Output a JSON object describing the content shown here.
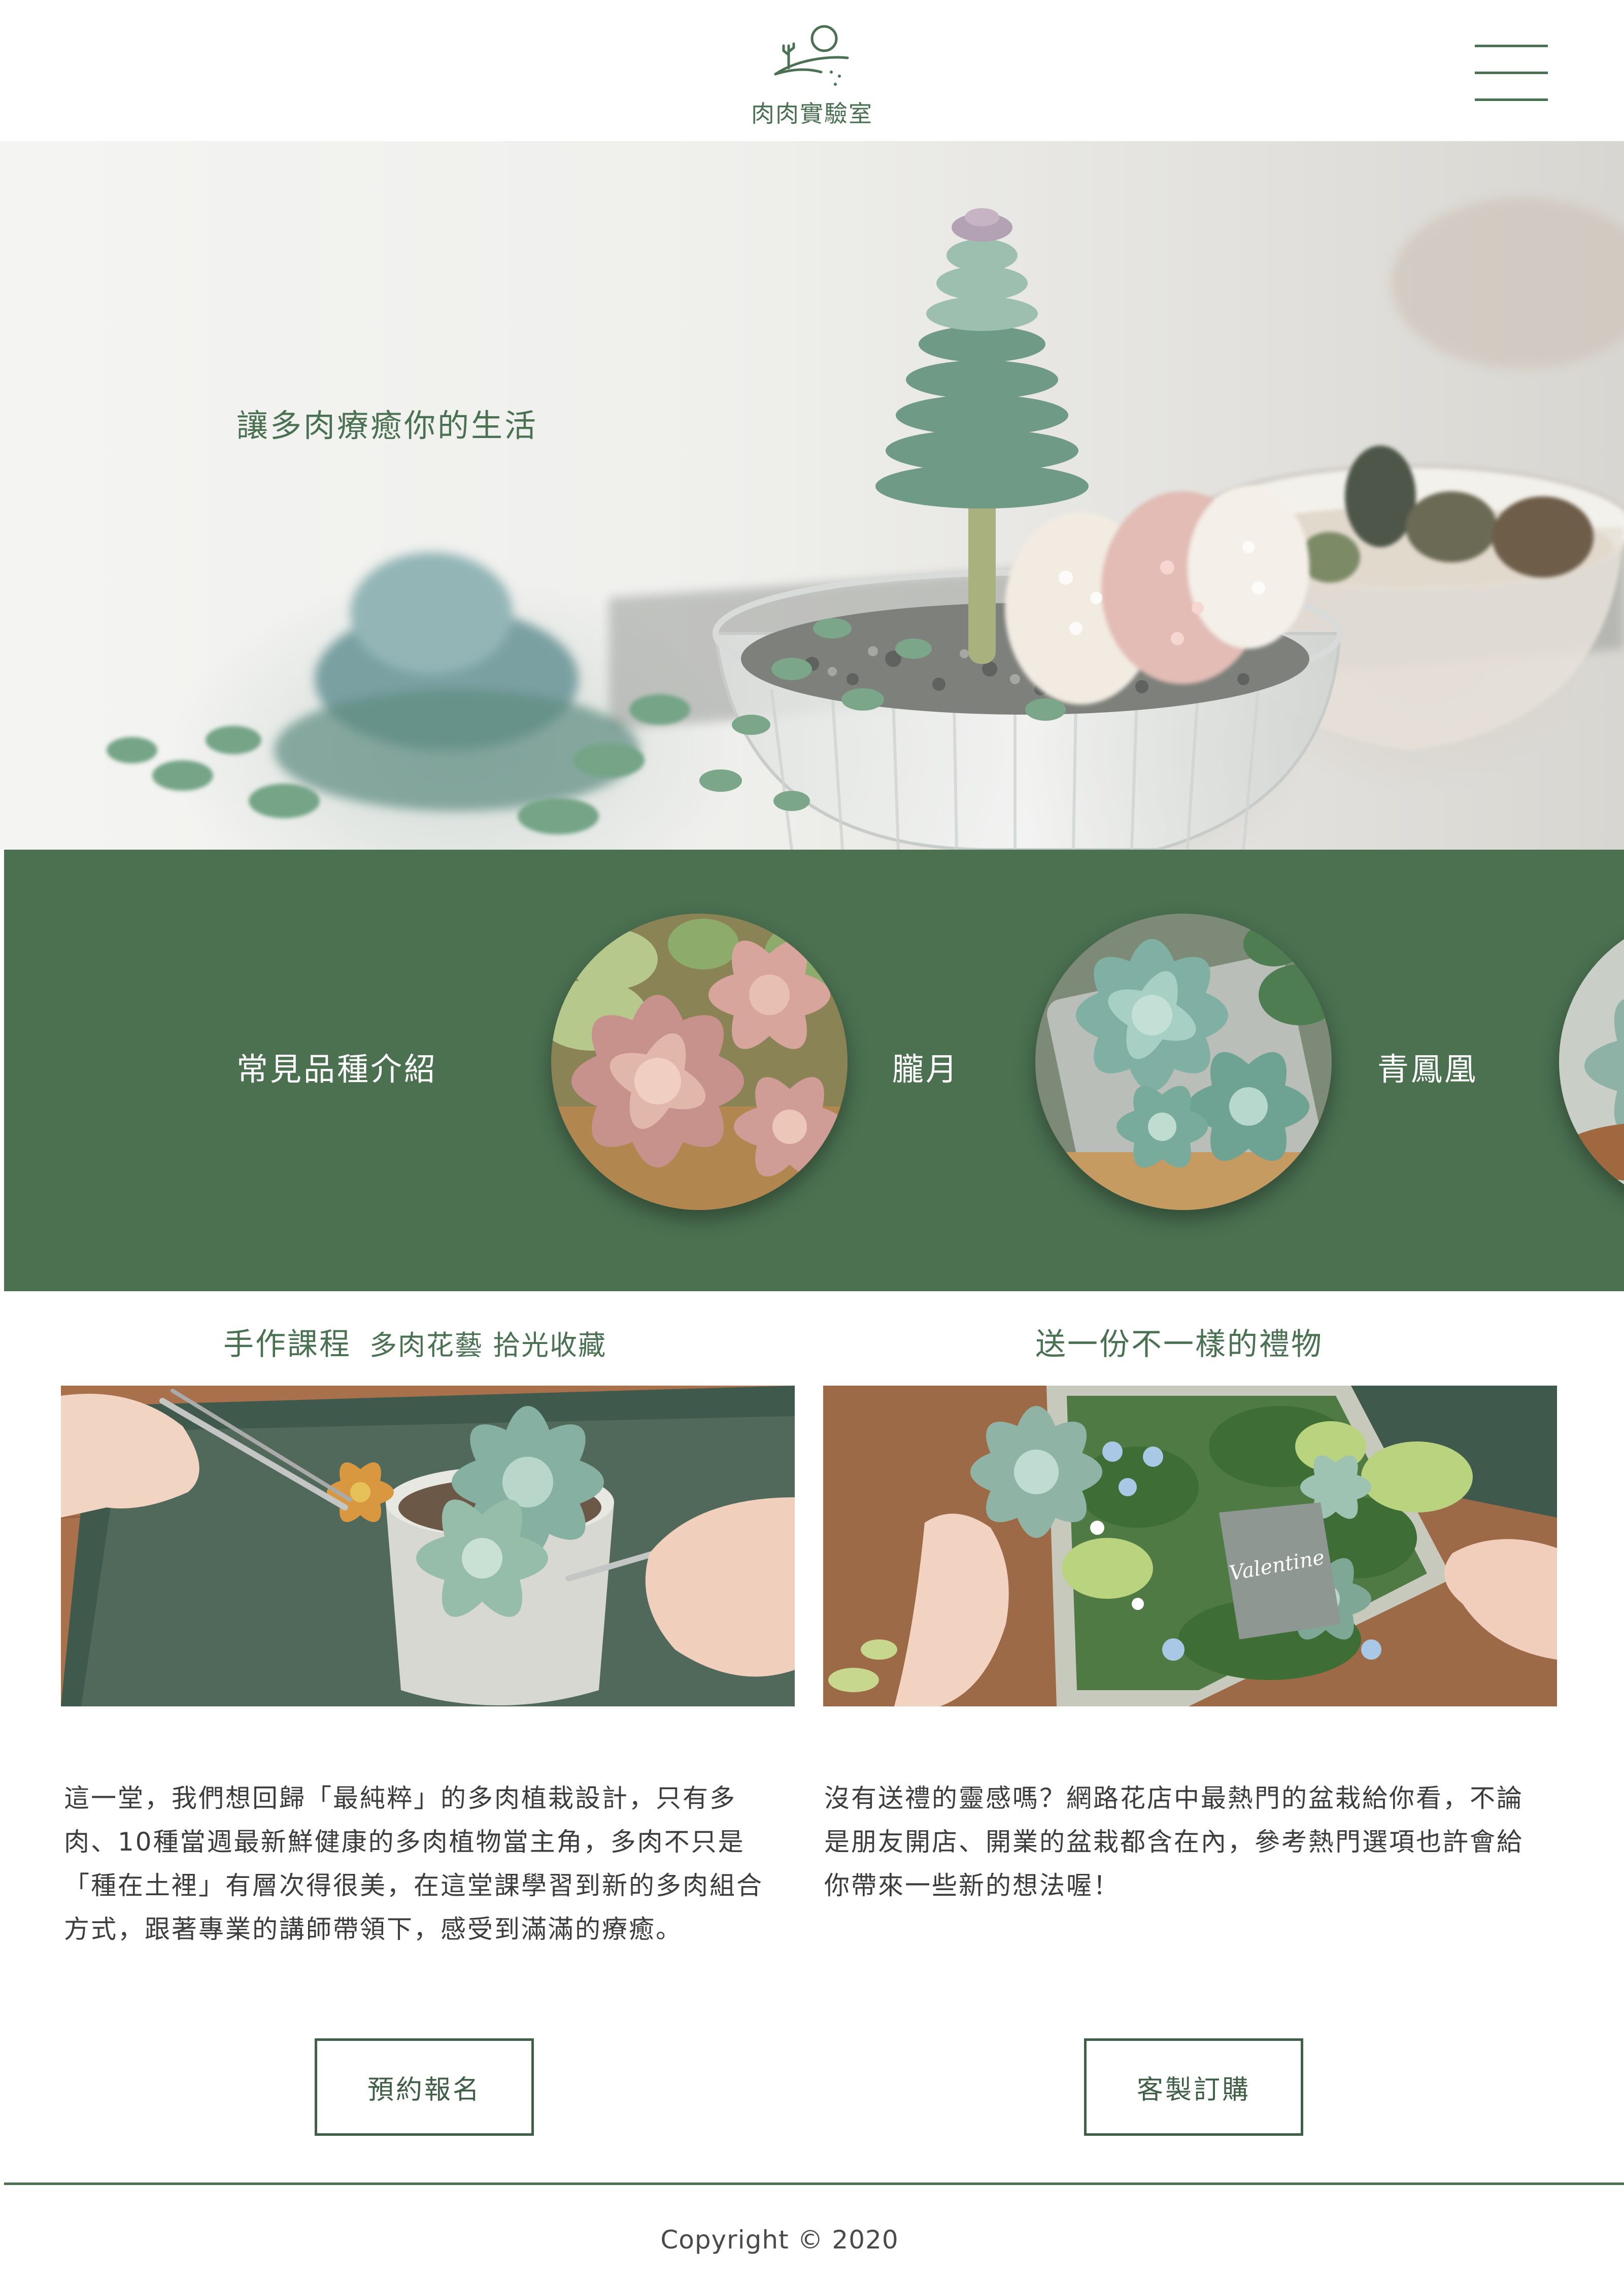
{
  "header": {
    "logo_text": "肉肉實驗室",
    "menu_icon": "hamburger-menu-icon"
  },
  "hero": {
    "title": "讓多肉療癒你的生活"
  },
  "varieties": {
    "heading": "常見品種介紹",
    "items": [
      {
        "label": "朧月"
      },
      {
        "label": "青鳳凰"
      }
    ]
  },
  "courses": {
    "title": "手作課程",
    "subtitle": "多肉花藝 拾光收藏",
    "description": "這一堂，我們想回歸「最純粹」的多肉植栽設計，只有多肉、10種當週最新鮮健康的多肉植物當主角，多肉不只是「種在土裡」有層次得很美，在這堂課學習到新的多肉組合方式，跟著專業的講師帶領下，感受到滿滿的療癒。",
    "button_label": "預約報名"
  },
  "gifts": {
    "title": "送一份不一樣的禮物",
    "description": "沒有送禮的靈感嗎？網路花店中最熱門的盆栽給你看，不論是朋友開店、開業的盆栽都含在內，參考熱門選項也許會給你帶來一些新的想法喔！",
    "button_label": "客製訂購",
    "card_script_text": "Valentine"
  },
  "footer": {
    "copyright": "Copyright © 2020"
  },
  "colors": {
    "brand_green": "#4b7151",
    "button_border": "#3f5f46",
    "text": "#3d3d3d",
    "background": "#ffffff"
  }
}
